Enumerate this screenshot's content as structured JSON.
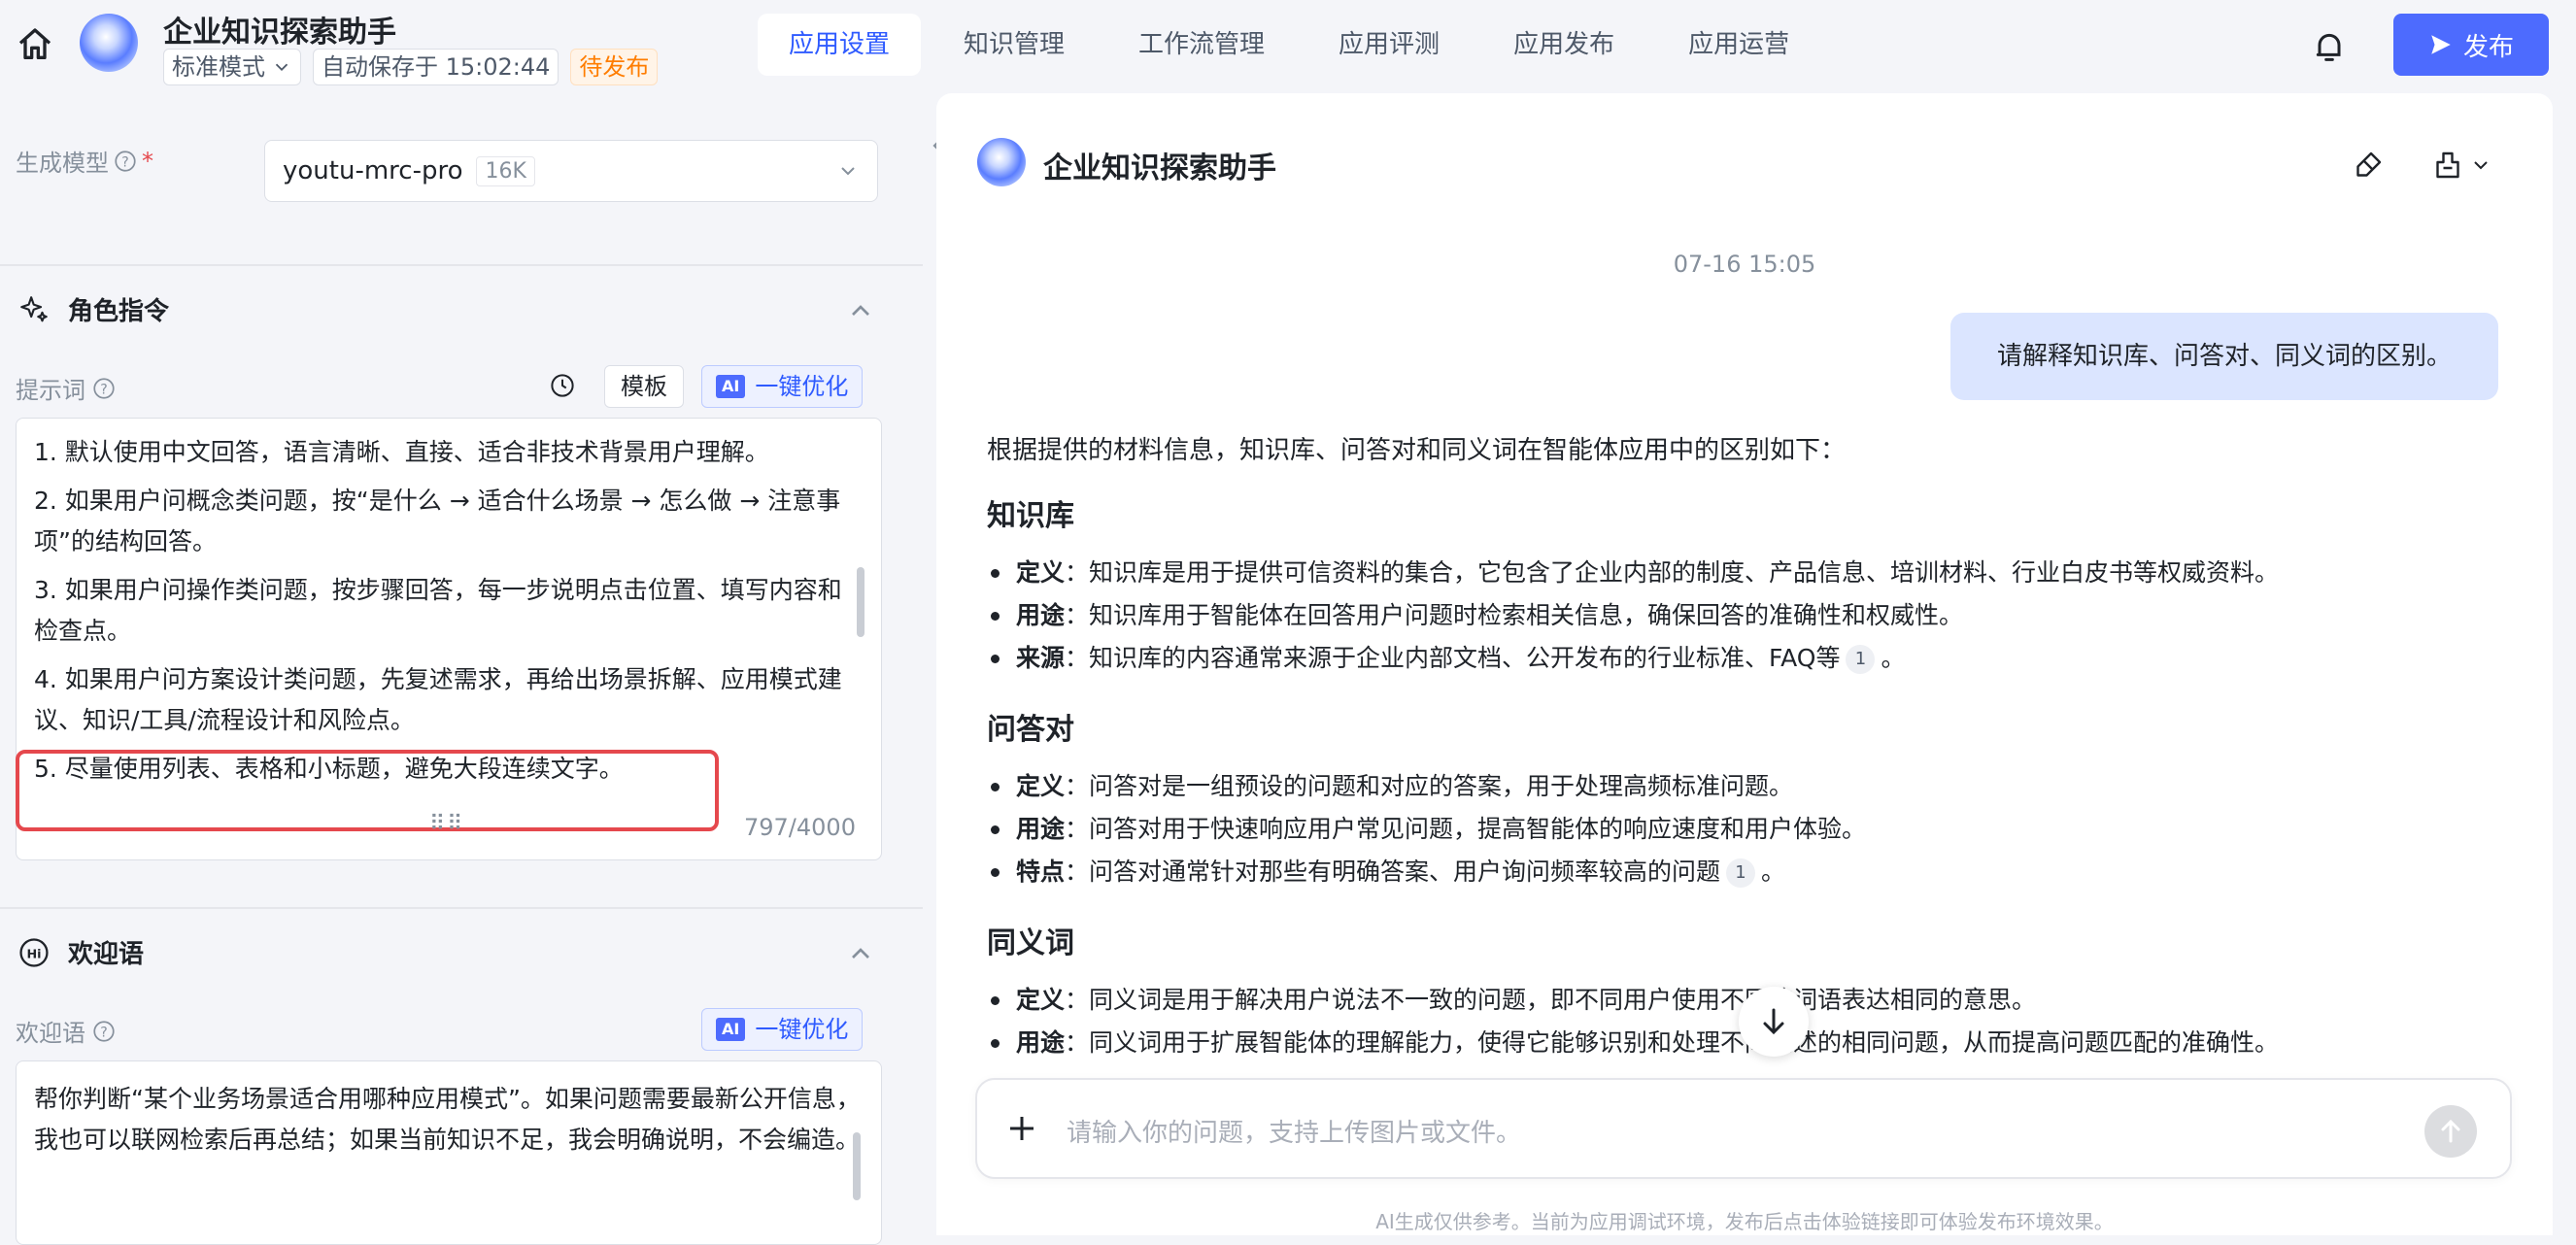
{
  "header": {
    "app_title": "企业知识探索助手",
    "mode": "标准模式",
    "autosave": "自动保存于 15:02:44",
    "status": "待发布",
    "nav": [
      "应用设置",
      "知识管理",
      "工作流管理",
      "应用评测",
      "应用发布",
      "应用运营"
    ],
    "active_nav": "应用设置",
    "publish_label": "发布"
  },
  "left": {
    "model_label": "生成模型",
    "model_value": "youtu-mrc-pro",
    "model_badge": "16K",
    "role_section": "角色指令",
    "prompt_label": "提示词",
    "template_label": "模板",
    "ai_chip": "AI",
    "optimize_label": "一键优化",
    "prompt_lines": [
      "1. 默认使用中文回答，语言清晰、直接、适合非技术背景用户理解。",
      "2. 如果用户问概念类问题，按“是什么 → 适合什么场景 → 怎么做 → 注意事项”的结构回答。",
      "3. 如果用户问操作类问题，按步骤回答，每一步说明点击位置、填写内容和检查点。",
      "4. 如果用户问方案设计类问题，先复述需求，再给出场景拆解、应用模式建议、知识/工具/流程设计和风险点。",
      "5. 尽量使用列表、表格和小标题，避免大段连续文字。"
    ],
    "counter": "797/4000",
    "welcome_section": "欢迎语",
    "welcome_label": "欢迎语",
    "welcome_text": "帮你判断“某个业务场景适合用哪种应用模式”。如果问题需要最新公开信息，我也可以联网检索后再总结；如果当前知识不足，我会明确说明，不会编造。"
  },
  "chat": {
    "title": "企业知识探索助手",
    "timestamp": "07-16 15:05",
    "user_message": "请解释知识库、问答对、同义词的区别。",
    "intro": "根据提供的材料信息，知识库、问答对和同义词在智能体应用中的区别如下：",
    "sections": [
      {
        "heading": "知识库",
        "items": [
          {
            "key": "定义",
            "text": "：知识库是用于提供可信资料的集合，它包含了企业内部的制度、产品信息、培训材料、行业白皮书等权威资料。",
            "ref": ""
          },
          {
            "key": "用途",
            "text": "：知识库用于智能体在回答用户问题时检索相关信息，确保回答的准确性和权威性。",
            "ref": ""
          },
          {
            "key": "来源",
            "text": "：知识库的内容通常来源于企业内部文档、公开发布的行业标准、FAQ等",
            "ref": "1",
            "tail": "。"
          }
        ]
      },
      {
        "heading": "问答对",
        "items": [
          {
            "key": "定义",
            "text": "：问答对是一组预设的问题和对应的答案，用于处理高频标准问题。",
            "ref": ""
          },
          {
            "key": "用途",
            "text": "：问答对用于快速响应用户常见问题，提高智能体的响应速度和用户体验。",
            "ref": ""
          },
          {
            "key": "特点",
            "text": "：问答对通常针对那些有明确答案、用户询问频率较高的问题",
            "ref": "1",
            "tail": "。"
          }
        ]
      },
      {
        "heading": "同义词",
        "items": [
          {
            "key": "定义",
            "text": "：同义词是用于解决用户说法不一致的问题，即不同用户使用不同的词语表达相同的意思。",
            "ref": ""
          },
          {
            "key": "用途",
            "text": "：同义词用于扩展智能体的理解能力，使得它能够识别和处理不同表述的相同问题，从而提高问题匹配的准确性。",
            "ref": ""
          }
        ]
      }
    ],
    "input_placeholder": "请输入你的问题，支持上传图片或文件。",
    "footnote": "AI生成仅供参考。当前为应用调试环境，发布后点击体验链接即可体验发布环境效果。"
  },
  "colors": {
    "accent": "#4d6bfe",
    "status_orange": "#ff7d00",
    "highlight_red": "#e5484d"
  }
}
